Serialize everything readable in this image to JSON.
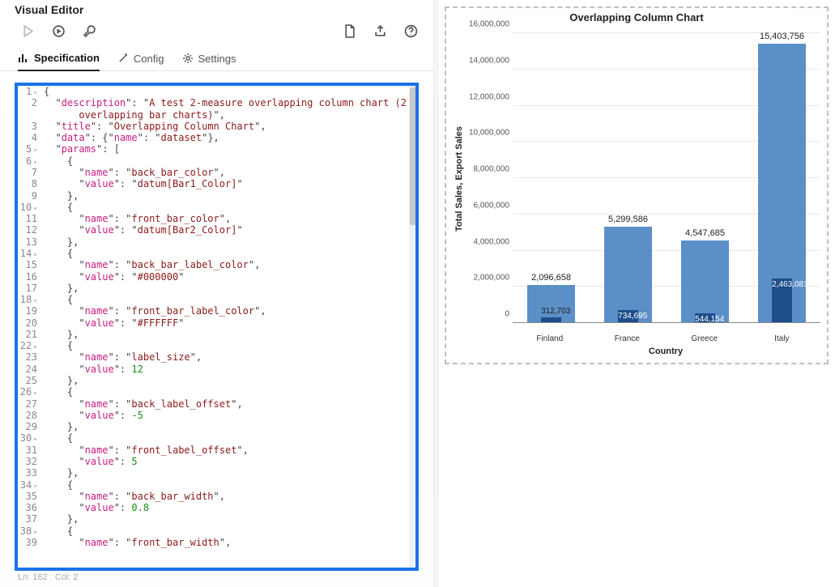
{
  "header": {
    "title": "Visual Editor"
  },
  "tabs": [
    {
      "label": "Specification",
      "active": true
    },
    {
      "label": "Config"
    },
    {
      "label": "Settings"
    }
  ],
  "statusbar": {
    "ln_label": "Ln: 162",
    "col_label": "Col: 2"
  },
  "code_lines": [
    {
      "n": 1,
      "fold": true,
      "segs": [
        [
          "o",
          "{"
        ]
      ]
    },
    {
      "n": 2,
      "fold": false,
      "segs": [
        [
          "p",
          "  \""
        ],
        [
          "k",
          "description"
        ],
        [
          "p",
          "\": \""
        ],
        [
          "s",
          "A test 2-measure overlapping column chart (2 "
        ]
      ]
    },
    {
      "n": null,
      "fold": false,
      "segs": [
        [
          "s",
          "      overlapping bar charts)"
        ],
        [
          "p",
          "\","
        ]
      ]
    },
    {
      "n": 3,
      "fold": false,
      "segs": [
        [
          "p",
          "  \""
        ],
        [
          "k",
          "title"
        ],
        [
          "p",
          "\": \""
        ],
        [
          "s",
          "Overlapping Column Chart"
        ],
        [
          "p",
          "\","
        ]
      ]
    },
    {
      "n": 4,
      "fold": false,
      "segs": [
        [
          "p",
          "  \""
        ],
        [
          "k",
          "data"
        ],
        [
          "p",
          "\": {\""
        ],
        [
          "k",
          "name"
        ],
        [
          "p",
          "\": \""
        ],
        [
          "s",
          "dataset"
        ],
        [
          "p",
          "\"},"
        ]
      ]
    },
    {
      "n": 5,
      "fold": true,
      "segs": [
        [
          "p",
          "  \""
        ],
        [
          "k",
          "params"
        ],
        [
          "p",
          "\": ["
        ]
      ]
    },
    {
      "n": 6,
      "fold": true,
      "segs": [
        [
          "p",
          "    {"
        ]
      ]
    },
    {
      "n": 7,
      "fold": false,
      "segs": [
        [
          "p",
          "      \""
        ],
        [
          "k",
          "name"
        ],
        [
          "p",
          "\": \""
        ],
        [
          "s",
          "back_bar_color"
        ],
        [
          "p",
          "\","
        ]
      ]
    },
    {
      "n": 8,
      "fold": false,
      "segs": [
        [
          "p",
          "      \""
        ],
        [
          "k",
          "value"
        ],
        [
          "p",
          "\": \""
        ],
        [
          "s",
          "datum[Bar1_Color]"
        ],
        [
          "p",
          "\""
        ]
      ]
    },
    {
      "n": 9,
      "fold": false,
      "segs": [
        [
          "p",
          "    },"
        ]
      ]
    },
    {
      "n": 10,
      "fold": true,
      "segs": [
        [
          "p",
          "    {"
        ]
      ]
    },
    {
      "n": 11,
      "fold": false,
      "segs": [
        [
          "p",
          "      \""
        ],
        [
          "k",
          "name"
        ],
        [
          "p",
          "\": \""
        ],
        [
          "s",
          "front_bar_color"
        ],
        [
          "p",
          "\","
        ]
      ]
    },
    {
      "n": 12,
      "fold": false,
      "segs": [
        [
          "p",
          "      \""
        ],
        [
          "k",
          "value"
        ],
        [
          "p",
          "\": \""
        ],
        [
          "s",
          "datum[Bar2_Color]"
        ],
        [
          "p",
          "\""
        ]
      ]
    },
    {
      "n": 13,
      "fold": false,
      "segs": [
        [
          "p",
          "    },"
        ]
      ]
    },
    {
      "n": 14,
      "fold": true,
      "segs": [
        [
          "p",
          "    {"
        ]
      ]
    },
    {
      "n": 15,
      "fold": false,
      "segs": [
        [
          "p",
          "      \""
        ],
        [
          "k",
          "name"
        ],
        [
          "p",
          "\": \""
        ],
        [
          "s",
          "back_bar_label_color"
        ],
        [
          "p",
          "\","
        ]
      ]
    },
    {
      "n": 16,
      "fold": false,
      "segs": [
        [
          "p",
          "      \""
        ],
        [
          "k",
          "value"
        ],
        [
          "p",
          "\": \""
        ],
        [
          "s",
          "#000000"
        ],
        [
          "p",
          "\""
        ]
      ]
    },
    {
      "n": 17,
      "fold": false,
      "segs": [
        [
          "p",
          "    },"
        ]
      ]
    },
    {
      "n": 18,
      "fold": true,
      "segs": [
        [
          "p",
          "    {"
        ]
      ]
    },
    {
      "n": 19,
      "fold": false,
      "segs": [
        [
          "p",
          "      \""
        ],
        [
          "k",
          "name"
        ],
        [
          "p",
          "\": \""
        ],
        [
          "s",
          "front_bar_label_color"
        ],
        [
          "p",
          "\","
        ]
      ]
    },
    {
      "n": 20,
      "fold": false,
      "segs": [
        [
          "p",
          "      \""
        ],
        [
          "k",
          "value"
        ],
        [
          "p",
          "\": \""
        ],
        [
          "s",
          "#FFFFFF"
        ],
        [
          "p",
          "\""
        ]
      ]
    },
    {
      "n": 21,
      "fold": false,
      "segs": [
        [
          "p",
          "    },"
        ]
      ]
    },
    {
      "n": 22,
      "fold": true,
      "segs": [
        [
          "p",
          "    {"
        ]
      ]
    },
    {
      "n": 23,
      "fold": false,
      "segs": [
        [
          "p",
          "      \""
        ],
        [
          "k",
          "name"
        ],
        [
          "p",
          "\": \""
        ],
        [
          "s",
          "label_size"
        ],
        [
          "p",
          "\","
        ]
      ]
    },
    {
      "n": 24,
      "fold": false,
      "segs": [
        [
          "p",
          "      \""
        ],
        [
          "k",
          "value"
        ],
        [
          "p",
          "\": "
        ],
        [
          "n",
          "12"
        ]
      ]
    },
    {
      "n": 25,
      "fold": false,
      "segs": [
        [
          "p",
          "    },"
        ]
      ]
    },
    {
      "n": 26,
      "fold": true,
      "segs": [
        [
          "p",
          "    {"
        ]
      ]
    },
    {
      "n": 27,
      "fold": false,
      "segs": [
        [
          "p",
          "      \""
        ],
        [
          "k",
          "name"
        ],
        [
          "p",
          "\": \""
        ],
        [
          "s",
          "back_label_offset"
        ],
        [
          "p",
          "\","
        ]
      ]
    },
    {
      "n": 28,
      "fold": false,
      "segs": [
        [
          "p",
          "      \""
        ],
        [
          "k",
          "value"
        ],
        [
          "p",
          "\": "
        ],
        [
          "n",
          "-5"
        ]
      ]
    },
    {
      "n": 29,
      "fold": false,
      "segs": [
        [
          "p",
          "    },"
        ]
      ]
    },
    {
      "n": 30,
      "fold": true,
      "segs": [
        [
          "p",
          "    {"
        ]
      ]
    },
    {
      "n": 31,
      "fold": false,
      "segs": [
        [
          "p",
          "      \""
        ],
        [
          "k",
          "name"
        ],
        [
          "p",
          "\": \""
        ],
        [
          "s",
          "front_label_offset"
        ],
        [
          "p",
          "\","
        ]
      ]
    },
    {
      "n": 32,
      "fold": false,
      "segs": [
        [
          "p",
          "      \""
        ],
        [
          "k",
          "value"
        ],
        [
          "p",
          "\": "
        ],
        [
          "n",
          "5"
        ]
      ]
    },
    {
      "n": 33,
      "fold": false,
      "segs": [
        [
          "p",
          "    },"
        ]
      ]
    },
    {
      "n": 34,
      "fold": true,
      "segs": [
        [
          "p",
          "    {"
        ]
      ]
    },
    {
      "n": 35,
      "fold": false,
      "segs": [
        [
          "p",
          "      \""
        ],
        [
          "k",
          "name"
        ],
        [
          "p",
          "\": \""
        ],
        [
          "s",
          "back_bar_width"
        ],
        [
          "p",
          "\","
        ]
      ]
    },
    {
      "n": 36,
      "fold": false,
      "segs": [
        [
          "p",
          "      \""
        ],
        [
          "k",
          "value"
        ],
        [
          "p",
          "\": "
        ],
        [
          "n",
          "0.8"
        ]
      ]
    },
    {
      "n": 37,
      "fold": false,
      "segs": [
        [
          "p",
          "    },"
        ]
      ]
    },
    {
      "n": 38,
      "fold": true,
      "segs": [
        [
          "p",
          "    {"
        ]
      ]
    },
    {
      "n": 39,
      "fold": false,
      "segs": [
        [
          "p",
          "      \""
        ],
        [
          "k",
          "name"
        ],
        [
          "p",
          "\": \""
        ],
        [
          "s",
          "front_bar_width"
        ],
        [
          "p",
          "\","
        ]
      ]
    }
  ],
  "chart_data": {
    "type": "bar",
    "title": "Overlapping Column Chart",
    "xlabel": "Country",
    "ylabel": "Total Sales, Export Sales",
    "ylim": [
      0,
      16000000
    ],
    "y_ticks": [
      0,
      2000000,
      4000000,
      6000000,
      8000000,
      10000000,
      12000000,
      14000000,
      16000000
    ],
    "y_tick_labels": [
      "0",
      "2,000,000",
      "4,000,000",
      "6,000,000",
      "8,000,000",
      "10,000,000",
      "12,000,000",
      "14,000,000",
      "16,000,000"
    ],
    "categories": [
      "Finland",
      "France",
      "Greece",
      "Italy"
    ],
    "series": [
      {
        "name": "Total Sales",
        "role": "back",
        "color": "#5b8fc7",
        "values": [
          2096658,
          5299586,
          4547685,
          15403756
        ],
        "labels": [
          "2,096,658",
          "5,299,586",
          "4,547,685",
          "15,403,756"
        ]
      },
      {
        "name": "Export Sales",
        "role": "front",
        "color": "#1f4e8c",
        "values": [
          312703,
          734695,
          544154,
          2463081
        ],
        "labels": [
          "312,703",
          "734,695",
          "544,154",
          "2,463,081"
        ]
      }
    ],
    "back_bar_label_color": "#000000",
    "front_bar_label_color": "#FFFFFF"
  },
  "colors": {
    "accent": "#1a73e8"
  }
}
